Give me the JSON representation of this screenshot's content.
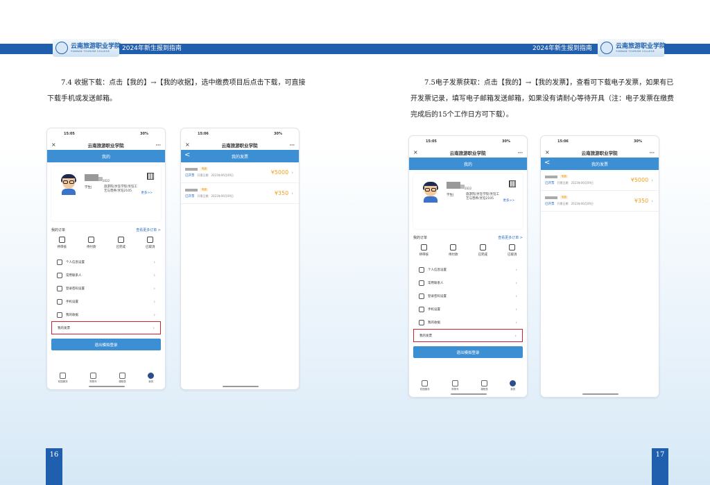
{
  "header": {
    "school_cn": "云南旅游职业学院",
    "school_en": "YUNNAN TOURISM COLLEGE",
    "guide_title": "2024年新生报到指南"
  },
  "left_page": {
    "paragraph": "7.4 收据下载：点击【我的】→【我的收据】，选中缴费项目后点击下载，可直接下载手机或发送邮箱。",
    "page_number": "16"
  },
  "right_page": {
    "paragraph": "7.5电子发票获取：点击【我的】→【我的发票】，查看可下载电子发票，如果有已开发票记录，填写电子邮箱发送邮箱，如果没有请耐心等待开具（注：电子发票在缴费完成后的15个工作日方可下载）。",
    "page_number": "17"
  },
  "phone_common": {
    "app_title": "云南旅游职业学院",
    "close_glyph": "×",
    "more_glyph": "···",
    "back_glyph": "<"
  },
  "my_screen": {
    "left_time": "15:05",
    "right_time": "15:05",
    "status_right": "30%",
    "header": "我的",
    "student_id": "2022",
    "role": "学生|",
    "major": "旅游院/烹饪学院/烹饪工艺与营养/烹饪2105",
    "more": "更多>>",
    "orders_title": "我的订单",
    "orders_link": "查看更多订单 >",
    "orders": [
      "待审核",
      "待付款",
      "已完成",
      "已取消"
    ],
    "menu": [
      "个人信息设置",
      "常用联系人",
      "登录密码设置",
      "手机设置",
      "我的收据",
      "我的发票"
    ],
    "logout": "退出模拟登录",
    "tabs": [
      "校园服务",
      "购物车",
      "课程表",
      "我的"
    ]
  },
  "invoice_screen": {
    "time": "15:06",
    "status_right": "30%",
    "header": "我的发票",
    "items": [
      {
        "tag": "电费",
        "status": "已开票",
        "date_label": "开票日期",
        "date": "2023年06月09日",
        "amount": "¥5000"
      },
      {
        "tag": "电费",
        "status": "已开票",
        "date_label": "开票日期",
        "date": "2023年06月09日",
        "amount": "¥350"
      }
    ]
  },
  "colors": {
    "brand_blue": "#1f5fae",
    "header_blue": "#3d8fd4",
    "highlight_red": "#d4202e",
    "amount_orange": "#f0a020"
  }
}
